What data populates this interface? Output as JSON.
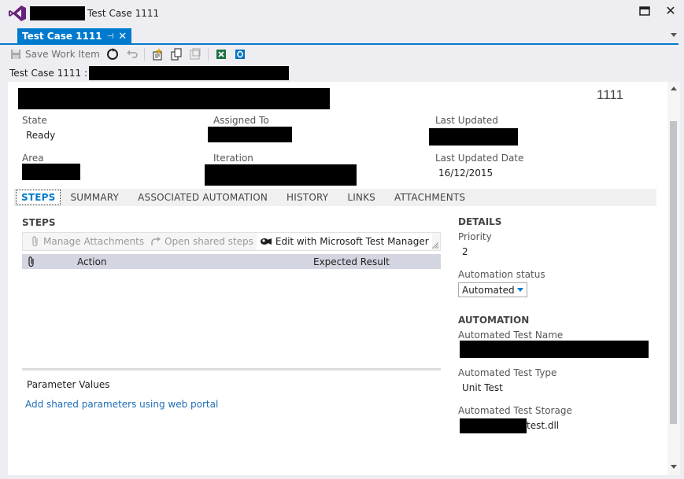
{
  "window": {
    "title": "Test Case 1111",
    "title_prefix_redacted": true
  },
  "doc_tab": {
    "label": "Test Case 1111",
    "pin_glyph": "⊣",
    "close_glyph": "✕"
  },
  "toolbar": {
    "save_label": "Save Work Item",
    "icons": [
      "save-icon",
      "refresh-icon",
      "undo-icon",
      "new-linked-icon",
      "copy-icon",
      "capture-icon",
      "excel-icon",
      "outlook-icon"
    ]
  },
  "header": {
    "label": "Test Case 1111 :"
  },
  "work_item": {
    "id": "1111",
    "fields": {
      "state_label": "State",
      "state_value": "Ready",
      "assigned_label": "Assigned To",
      "last_updated_label": "Last Updated",
      "area_label": "Area",
      "iteration_label": "Iteration",
      "last_updated_date_label": "Last Updated Date",
      "last_updated_date_value": "16/12/2015"
    }
  },
  "form_tabs": [
    "STEPS",
    "SUMMARY",
    "ASSOCIATED AUTOMATION",
    "HISTORY",
    "LINKS",
    "ATTACHMENTS"
  ],
  "steps": {
    "title": "STEPS",
    "toolbar": {
      "manage_attachments": "Manage Attachments",
      "open_shared_steps": "Open shared steps",
      "edit_mtm": "Edit with Microsoft Test Manager"
    },
    "columns": {
      "action": "Action",
      "expected": "Expected Result"
    },
    "parameter_values_label": "Parameter Values",
    "add_shared_params_link": "Add shared parameters using web portal"
  },
  "details": {
    "title": "DETAILS",
    "priority_label": "Priority",
    "priority_value": "2",
    "automation_status_label": "Automation status",
    "automation_status_value": "Automated"
  },
  "automation": {
    "title": "AUTOMATION",
    "test_name_label": "Automated Test Name",
    "test_type_label": "Automated Test Type",
    "test_type_value": "Unit Test",
    "test_storage_label": "Automated Test Storage",
    "test_storage_suffix": "test.dll"
  },
  "colors": {
    "accent": "#007acc",
    "link": "#1e6db7",
    "vs_purple": "#68217a"
  }
}
